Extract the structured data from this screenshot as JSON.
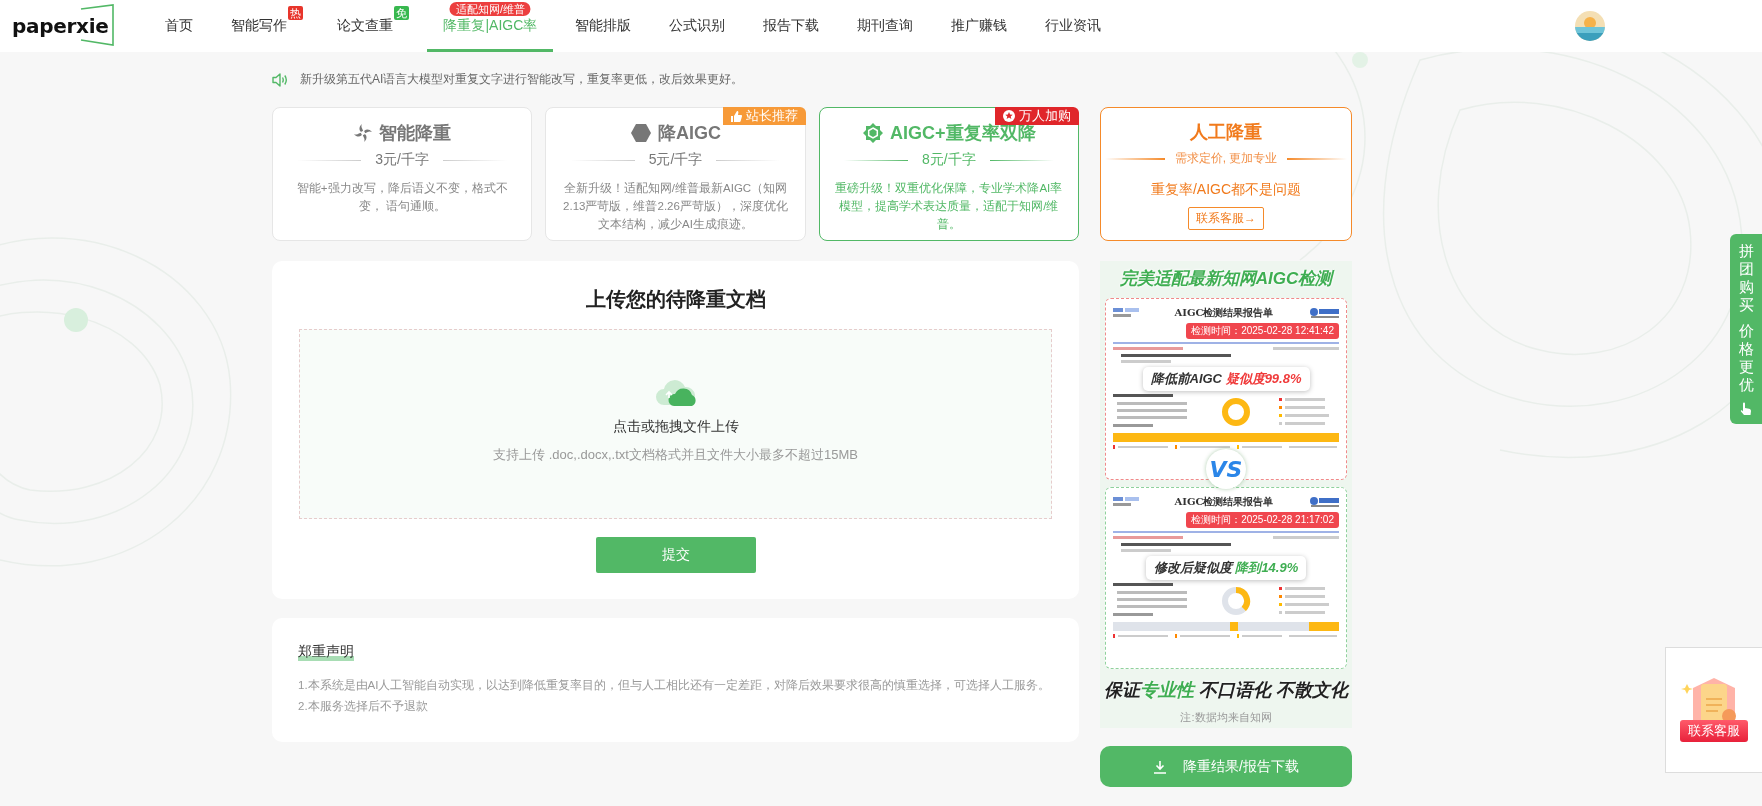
{
  "nav": {
    "logo": "paperxie",
    "items": [
      {
        "label": "首页",
        "selected": false
      },
      {
        "label": "智能写作",
        "selected": false,
        "badge": {
          "text": "热",
          "kind": "hot"
        }
      },
      {
        "label": "论文查重",
        "selected": false,
        "badge": {
          "text": "免",
          "kind": "free"
        }
      },
      {
        "label": "降重复|AIGC率",
        "selected": true,
        "badge": {
          "text": "适配知网/维普",
          "kind": "top"
        }
      },
      {
        "label": "智能排版",
        "selected": false
      },
      {
        "label": "公式识别",
        "selected": false
      },
      {
        "label": "报告下载",
        "selected": false
      },
      {
        "label": "期刊查询",
        "selected": false
      },
      {
        "label": "推广赚钱",
        "selected": false
      },
      {
        "label": "行业资讯",
        "selected": false
      }
    ]
  },
  "notice": "新升级第五代AI语言大模型对重复文字进行智能改写，重复率更低，改后效果更好。",
  "plans": [
    {
      "kind": "service",
      "title": "智能降重",
      "price": "3元/千字",
      "description": "智能+强力改写，降后语义不变，格式不变， 语句通顺。",
      "selected": false
    },
    {
      "kind": "service",
      "title": "降AIGC",
      "price": "5元/千字",
      "description": "全新升级！适配知网/维普最新AIGC（知网2.13严苛版，维普2.26严苛版），深度优化文本结构，减少AI生成痕迹。",
      "selected": false,
      "ribbon": {
        "text": "站长推荐",
        "kind": "recommend"
      }
    },
    {
      "kind": "service",
      "title": "AIGC+重复率双降",
      "price": "8元/千字",
      "description": "重磅升级！双重优化保障，专业学术降AI率模型，提高学术表达质量，适配于知网/维普。",
      "selected": true,
      "ribbon": {
        "text": "万人加购",
        "kind": "popular"
      }
    },
    {
      "kind": "manual",
      "title": "人工降重",
      "subtitle": "需求定价, 更加专业",
      "description": "重复率/AIGC都不是问题",
      "button": "联系客服→"
    }
  ],
  "upload": {
    "title": "上传您的待降重文档",
    "prompt": "点击或拖拽文件上传",
    "hint": "支持上传 .doc,.docx,.txt文档格式并且文件大小最多不超过15MB",
    "submit": "提交"
  },
  "disclaimer": {
    "title": "郑重声明",
    "lines": [
      "1.本系统是由AI人工智能自动实现，以达到降低重复率目的，但与人工相比还有一定差距，对降后效果要求很高的慎重选择，可选择人工服务。",
      "2.本服务选择后不予退款"
    ]
  },
  "promo": {
    "title": "完美适配最新知网AIGC检测",
    "reports": [
      {
        "kind": "before",
        "heading": "AIGC检测结果报告单",
        "time": "检测时间：2025-02-28 12:41:42",
        "label": "降低前AIGC",
        "result": "疑似度99.8%"
      },
      {
        "kind": "after",
        "heading": "AIGC检测结果报告单",
        "time": "检测时间：2025-02-28 21:17:02",
        "label": "修改后疑似度",
        "result": "降到14.9%"
      }
    ],
    "versus": "VS",
    "slogan": [
      {
        "text": "保证",
        "highlight": false
      },
      {
        "text": "专业性",
        "highlight": true
      },
      {
        "text": " 不口语化 不散文化",
        "highlight": false
      }
    ],
    "note": "注:数据均来自知网"
  },
  "download": "降重结果/报告下载",
  "float_tab": [
    "拼团购买",
    "价格更优"
  ],
  "contact": "联系客服"
}
